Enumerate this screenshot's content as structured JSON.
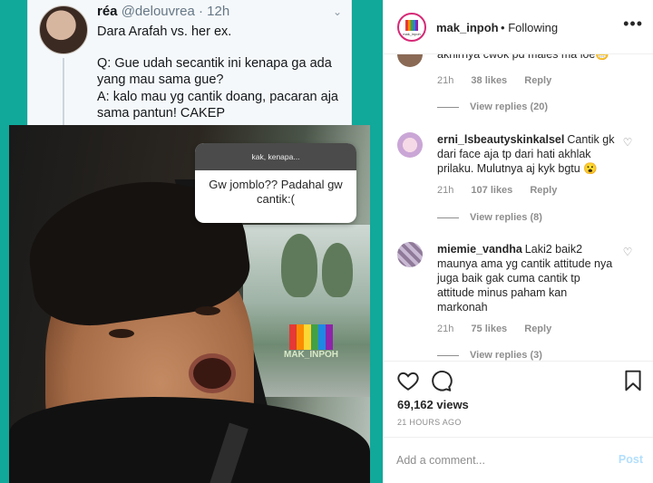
{
  "tweet": {
    "name": "réa",
    "handle": "@delouvrea",
    "separator": "·",
    "time": "12h",
    "line1": "Dara Arafah vs. her ex.",
    "q": "Q: Gue udah secantik ini kenapa ga ada yang mau sama gue?",
    "a": "A: kalo mau yg cantik doang, pacaran aja sama pantun! CAKEP"
  },
  "story_question": {
    "header": "kak, kenapa...",
    "answer": "Gw jomblo?? Padahal gw cantik:("
  },
  "watermark": {
    "text": "MAK_INPOH"
  },
  "post_header": {
    "username": "mak_inpoh",
    "separator": "•",
    "follow_status": "Following",
    "avatar_text": "mak_inpoh",
    "more": "•••"
  },
  "comments": [
    {
      "username": "",
      "text": "akhirnya cwok pd males ma loe😁",
      "age": "21h",
      "likes": "38 likes",
      "reply": "Reply",
      "view_replies": "View replies (20)"
    },
    {
      "username": "erni_lsbeautyskinkalsel",
      "text": "Cantik gk dari face aja tp dari hati akhlak prilaku. Mulutnya aj kyk bgtu 😮",
      "age": "21h",
      "likes": "107 likes",
      "reply": "Reply",
      "view_replies": "View replies (8)"
    },
    {
      "username": "miemie_vandha",
      "text": "Laki2 baik2 maunya ama yg cantik attitude nya juga baik gak cuma cantik tp attitude minus paham kan markonah",
      "age": "21h",
      "likes": "75 likes",
      "reply": "Reply",
      "view_replies": "View replies (3)"
    }
  ],
  "actions": {
    "views": "69,162 views",
    "posted_ago": "21 HOURS AGO",
    "icons": [
      "heart-icon",
      "comment-icon",
      "bookmark-icon"
    ]
  },
  "add_comment": {
    "placeholder": "Add a comment...",
    "post_label": "Post"
  },
  "colors": {
    "teal_background": "#10a99a",
    "link_muted": "#8e8e8e",
    "post_disabled": "#b2dffc",
    "text": "#262626"
  }
}
